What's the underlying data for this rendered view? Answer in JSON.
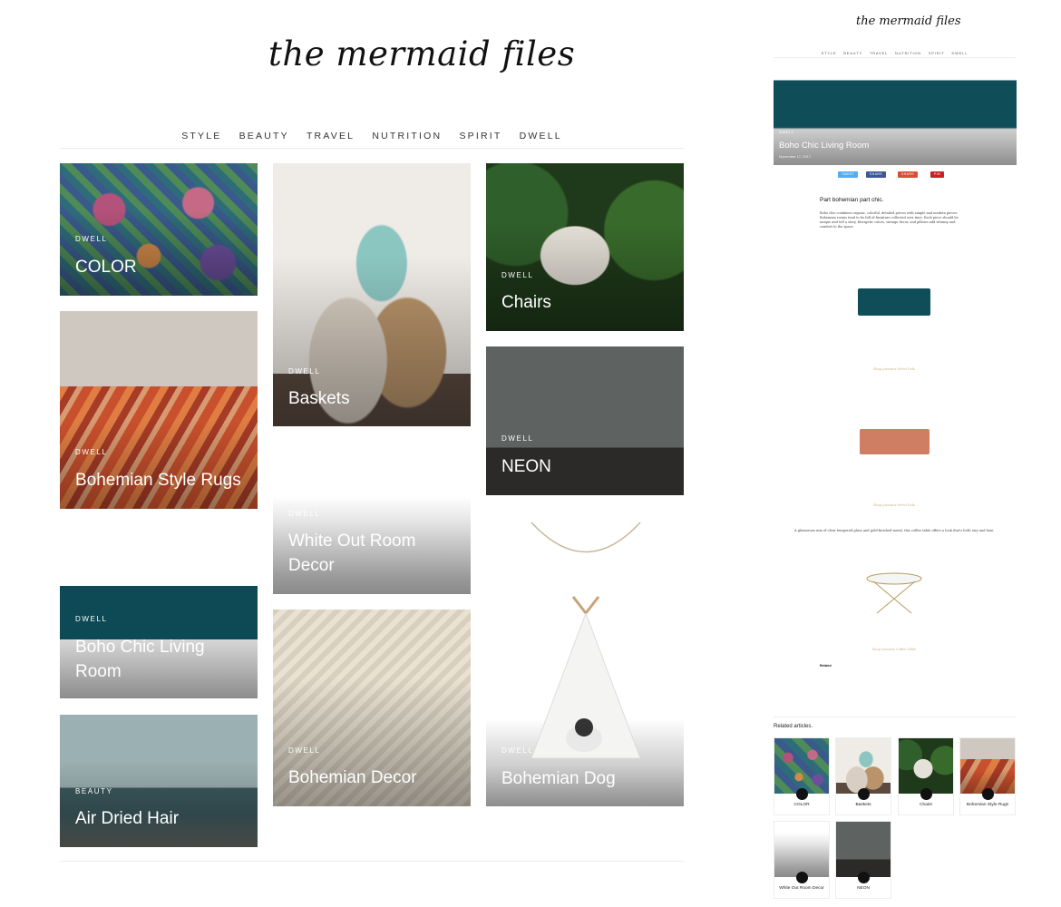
{
  "site": {
    "logo": "the mermaid files"
  },
  "nav": {
    "items": [
      "STYLE",
      "BEAUTY",
      "TRAVEL",
      "NUTRITION",
      "SPIRIT",
      "DWELL"
    ]
  },
  "posts": [
    {
      "category": "DWELL",
      "title": "COLOR"
    },
    {
      "category": "DWELL",
      "title": "Bohemian Style Rugs"
    },
    {
      "category": "DWELL",
      "title": "Boho Chic Living Room"
    },
    {
      "category": "BEAUTY",
      "title": "Air Dried Hair"
    },
    {
      "category": "DWELL",
      "title": "Baskets"
    },
    {
      "category": "DWELL",
      "title": "White Out Room Decor"
    },
    {
      "category": "DWELL",
      "title": "Bohemian Decor"
    },
    {
      "category": "DWELL",
      "title": "Chairs"
    },
    {
      "category": "DWELL",
      "title": "NEON"
    },
    {
      "category": "DWELL",
      "title": "Bohemian Dog"
    }
  ],
  "article": {
    "logo": "the mermaid files",
    "nav": [
      "STYLE",
      "BEAUTY",
      "TRAVEL",
      "NUTRITION",
      "SPIRIT",
      "DWELL"
    ],
    "category": "DWELL",
    "title": "Boho Chic Living Room",
    "date": "November 17, 2017",
    "share": [
      "TWEET",
      "SHARE",
      "SHARE",
      "PIN"
    ],
    "subtitle": "Part bohemian part chic.",
    "paragraph": "Boho chic combines organic, colorful, detailed pieces with simple and modern pieces. Bohemian rooms tend to be full of furniture collected over time. Each piece should be unique and tell a story. Energetic colors, vintage decor, and pillows add whimsy and comfort to the space.",
    "links": [
      "Shop Josseant Velvet Sofa",
      "Shop Josseant Velvet Sofa",
      "Shop Josseant Coffee Table"
    ],
    "caption": "A glamorous mix of clear tempered glass and gold-finished metal, this coffee table offers a look that's both airy and luxe.",
    "related_label": "Related",
    "related_articles_title": "Related articles.",
    "related": [
      "COLOR",
      "Baskets",
      "Chairs",
      "Bohemian Style Rugs",
      "White Out Room Decor",
      "NEON"
    ]
  }
}
